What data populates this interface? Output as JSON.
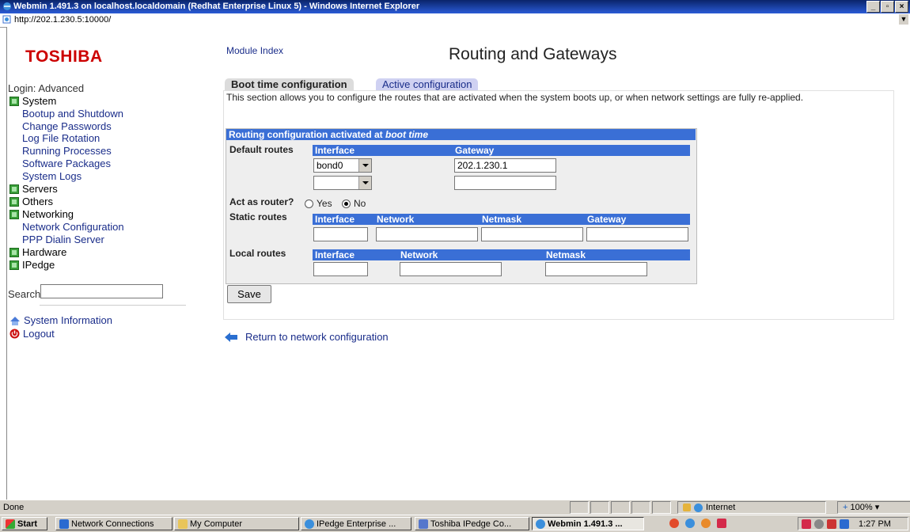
{
  "window": {
    "title": "Webmin 1.491.3 on localhost.localdomain (Redhat Enterprise Linux 5) - Windows Internet Explorer",
    "controls": [
      "_",
      "▫",
      "×"
    ]
  },
  "address_bar": {
    "url": "http://202.1.230.5:10000/"
  },
  "sidebar": {
    "logo": "TOSHIBA",
    "login": "Login: Advanced",
    "categories": [
      {
        "label": "System",
        "items": [
          "Bootup and Shutdown",
          "Change Passwords",
          "Log File Rotation",
          "Running Processes",
          "Software Packages",
          "System Logs"
        ]
      },
      {
        "label": "Servers"
      },
      {
        "label": "Others"
      },
      {
        "label": "Networking",
        "items": [
          "Network Configuration",
          "PPP Dialin Server"
        ]
      },
      {
        "label": "Hardware"
      },
      {
        "label": "IPedge"
      }
    ],
    "search_label": "Search:",
    "search_value": "",
    "system_information": "System Information",
    "logout": "Logout"
  },
  "main": {
    "module_index": "Module Index",
    "title": "Routing and Gateways",
    "tabs": [
      {
        "label": "Boot time configuration",
        "active": true
      },
      {
        "label": "Active configuration",
        "active": false
      }
    ],
    "description": "This section allows you to configure the routes that are activated when the system boots up, or when network settings are fully re-applied.",
    "form": {
      "heading_prefix": "Routing configuration activated at ",
      "heading_em": "boot time",
      "default_routes": {
        "label": "Default routes",
        "columns": [
          "Interface",
          "Gateway"
        ],
        "rows": [
          {
            "interface": "bond0",
            "gateway": "202.1.230.1"
          },
          {
            "interface": "",
            "gateway": ""
          }
        ]
      },
      "act_as_router": {
        "label": "Act as router?",
        "options": [
          "Yes",
          "No"
        ],
        "selected": "No"
      },
      "static_routes": {
        "label": "Static routes",
        "columns": [
          "Interface",
          "Network",
          "Netmask",
          "Gateway"
        ],
        "values": [
          "",
          "",
          "",
          ""
        ]
      },
      "local_routes": {
        "label": "Local routes",
        "columns": [
          "Interface",
          "Network",
          "Netmask"
        ],
        "values": [
          "",
          "",
          ""
        ]
      }
    },
    "save_label": "Save",
    "return_link": "Return to network configuration"
  },
  "status_bar": {
    "status": "Done",
    "zone": "Internet",
    "zoom": "100%"
  },
  "taskbar": {
    "start": "Start",
    "tasks": [
      {
        "label": "Network Connections",
        "active": false
      },
      {
        "label": "My Computer",
        "active": false
      },
      {
        "label": "IPedge Enterprise ...",
        "active": false
      },
      {
        "label": "Toshiba IPedge Co...",
        "active": false
      },
      {
        "label": "Webmin 1.491.3 ...",
        "active": true
      }
    ],
    "clock": "1:27 PM"
  },
  "colors": {
    "title_bar": "#0a246a",
    "form_header": "#3a6fd6",
    "link": "#1a2d8a",
    "logo": "#cc0000"
  }
}
